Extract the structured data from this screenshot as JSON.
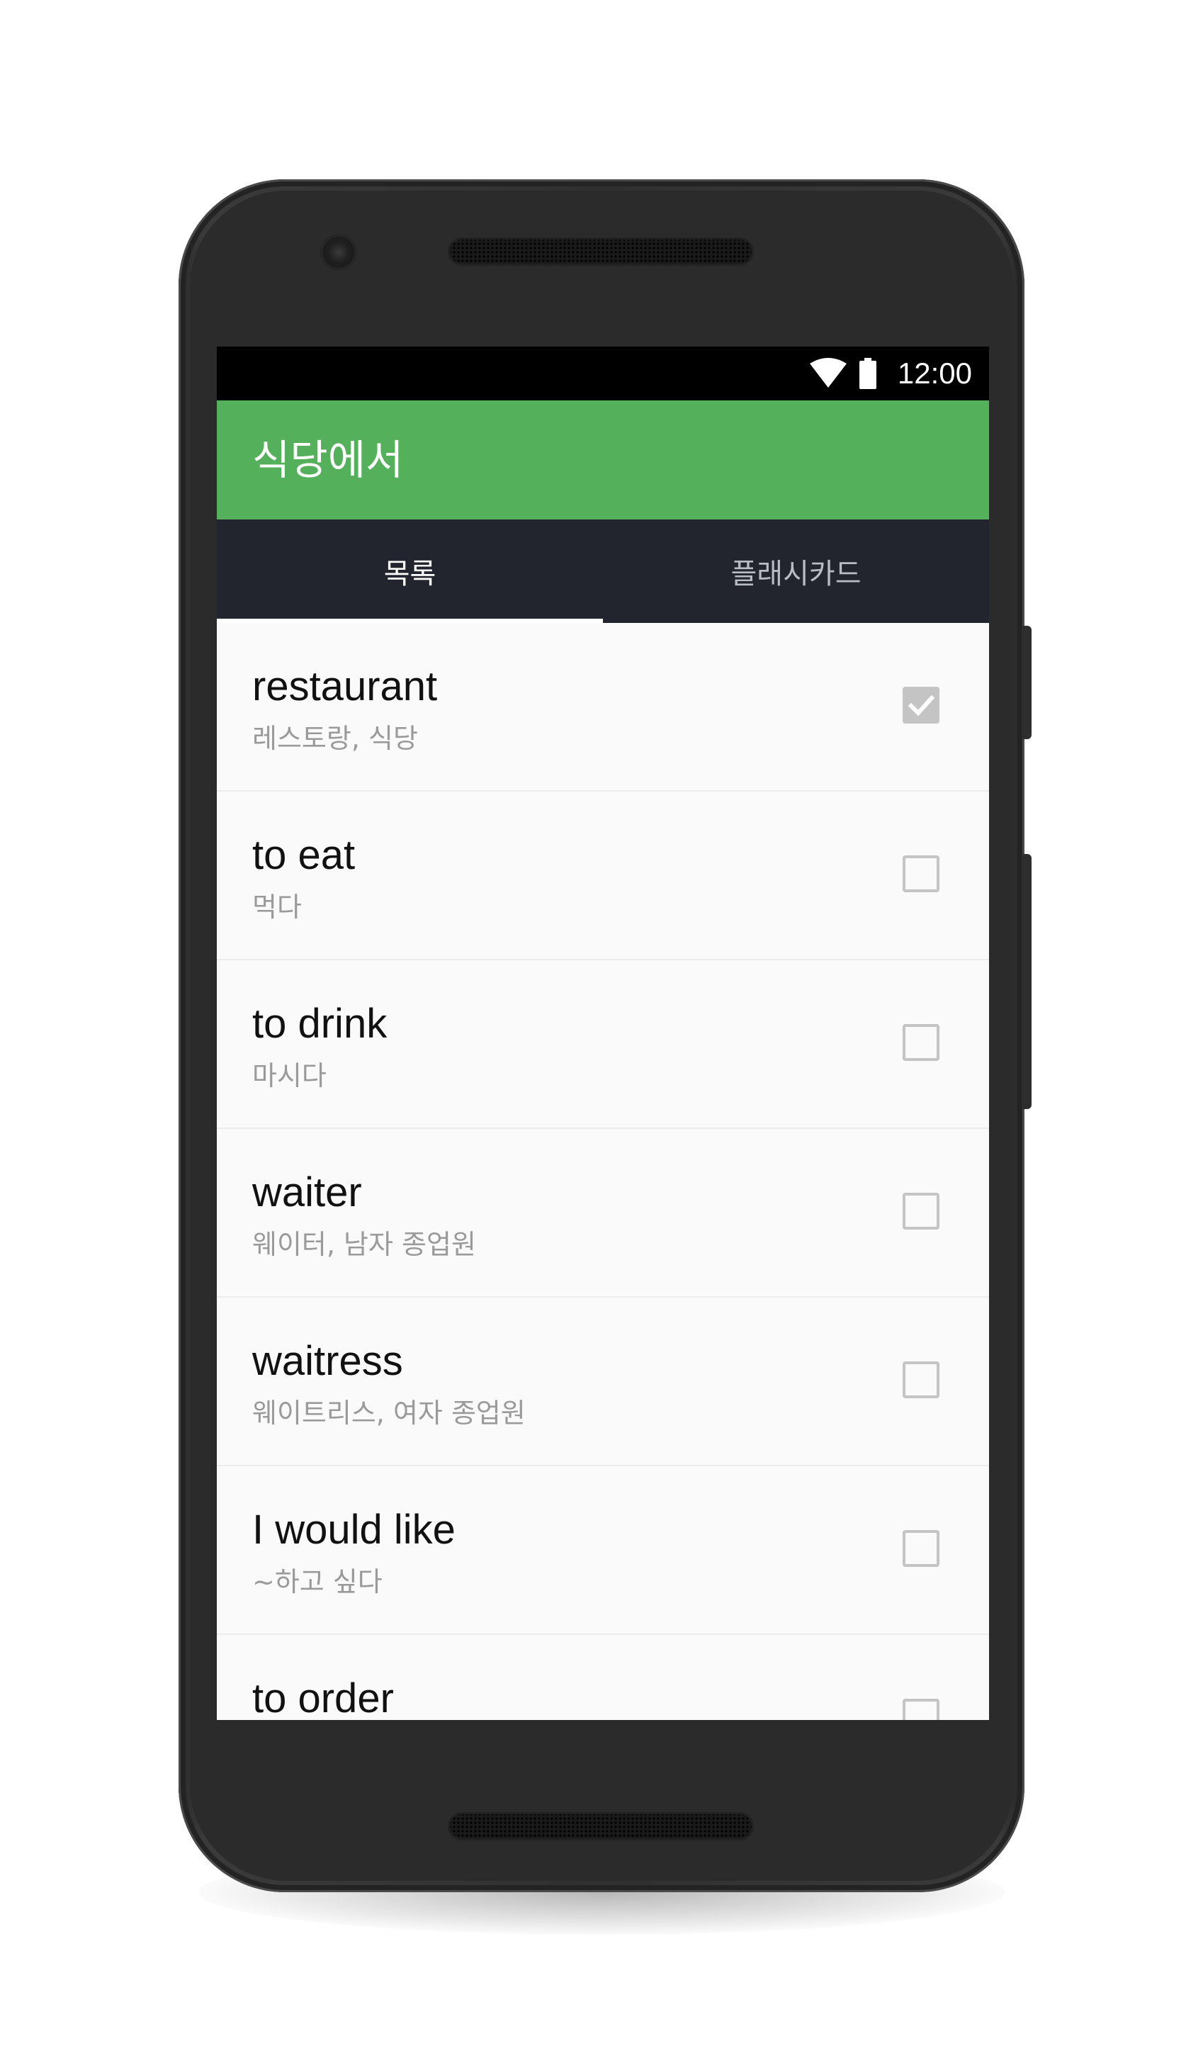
{
  "status_bar": {
    "time": "12:00",
    "icons": [
      "wifi-icon",
      "battery-icon"
    ]
  },
  "app_bar": {
    "title": "식당에서",
    "color": "#54b05a"
  },
  "tabs": [
    {
      "label": "목록",
      "active": true
    },
    {
      "label": "플래시카드",
      "active": false
    }
  ],
  "vocab": [
    {
      "word": "restaurant",
      "meaning": "레스토랑, 식당",
      "checked": true
    },
    {
      "word": "to eat",
      "meaning": "먹다",
      "checked": false
    },
    {
      "word": "to drink",
      "meaning": "마시다",
      "checked": false
    },
    {
      "word": "waiter",
      "meaning": "웨이터, 남자 종업원",
      "checked": false
    },
    {
      "word": "waitress",
      "meaning": "웨이트리스, 여자 종업원",
      "checked": false
    },
    {
      "word": "I would like",
      "meaning": "~하고 싶다",
      "checked": false
    },
    {
      "word": "to order",
      "meaning": "",
      "checked": false
    }
  ],
  "colors": {
    "tab_bar": "#22252d",
    "list_background": "#fafafa",
    "checkbox": "#c4c4c4"
  }
}
